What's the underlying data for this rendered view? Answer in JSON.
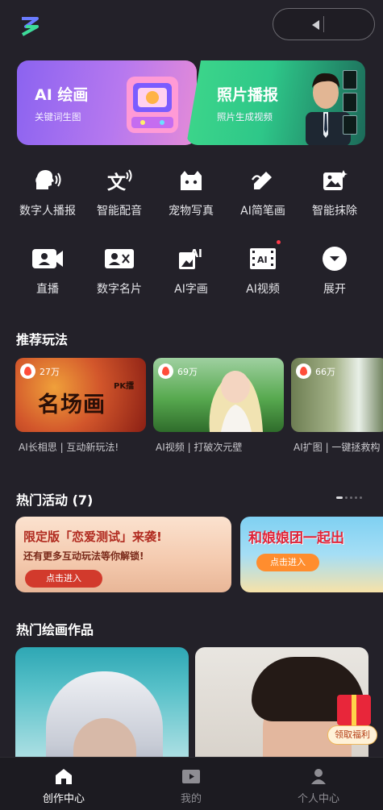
{
  "header": {
    "logo_icon": "app-logo-icon",
    "capsule_icons": [
      "more-icon",
      "close-icon"
    ]
  },
  "feature_cards": [
    {
      "title": "AI 绘画",
      "subtitle": "关键词生图",
      "colors": [
        "#8b63f0",
        "#e58bd7"
      ]
    },
    {
      "title": "照片播报",
      "subtitle": "照片生成视频",
      "colors": [
        "#3ed78a",
        "#1c6a59"
      ]
    }
  ],
  "tools": [
    {
      "label": "数字人播报",
      "icon": "speaking-head-icon"
    },
    {
      "label": "智能配音",
      "icon": "text-voice-icon"
    },
    {
      "label": "宠物写真",
      "icon": "pet-icon"
    },
    {
      "label": "AI简笔画",
      "icon": "pencil-sketch-icon"
    },
    {
      "label": "智能抹除",
      "icon": "image-erase-icon"
    },
    {
      "label": "直播",
      "icon": "live-camera-icon"
    },
    {
      "label": "数字名片",
      "icon": "business-card-icon"
    },
    {
      "label": "AI字画",
      "icon": "ai-calligraphy-icon"
    },
    {
      "label": "AI视频",
      "icon": "ai-video-icon",
      "red_dot": true
    },
    {
      "label": "展开",
      "icon": "expand-icon"
    }
  ],
  "recommend": {
    "title": "推荐玩法",
    "items": [
      {
        "count": "27万",
        "caption": "AI长相思 | 互动新玩法!",
        "art_text": "名场画",
        "art_tag": "PK擂"
      },
      {
        "count": "69万",
        "caption": "AI视频 | 打破次元壁"
      },
      {
        "count": "66万",
        "caption": "AI扩图 | 一键拯救构"
      }
    ]
  },
  "activities": {
    "title": "热门活动 (7)",
    "items": [
      {
        "headline": "限定版「恋爱测试」来袭!",
        "subline": "还有更多互动玩法等你解锁!",
        "button": "点击进入"
      },
      {
        "headline": "和娘娘团一起出",
        "button": "点击进入"
      }
    ]
  },
  "artworks": {
    "title": "热门绘画作品"
  },
  "gift": {
    "label": "领取福利",
    "icon": "gift-icon"
  },
  "bottom_nav": [
    {
      "label": "创作中心",
      "icon": "home-icon",
      "active": true
    },
    {
      "label": "我的",
      "icon": "play-folder-icon",
      "active": false
    },
    {
      "label": "个人中心",
      "icon": "person-icon",
      "active": false
    }
  ]
}
